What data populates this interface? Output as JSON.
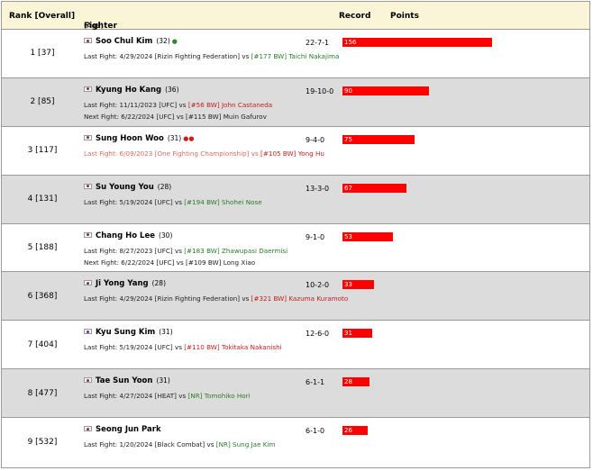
{
  "header": {
    "rank": "Rank [Overall]",
    "fighter": "Fighter",
    "age": "(Age)",
    "record": "Record",
    "points": "Points"
  },
  "colors": {
    "bar": "#ff0000",
    "header_bg": "#fbf5d8",
    "alt_row": "#dcdcdc",
    "win_text": "#2a7a2a",
    "loss_text": "#c21d1d"
  },
  "max_points": 156,
  "rows": [
    {
      "rank": "1 [37]",
      "name": "Soo Chul Kim",
      "age": "(32)",
      "record": "22-7-1",
      "points": "156",
      "l1": {
        "prefix": "Last Fight: 4/29/2024 [Rizin Fighting Federation] vs ",
        "opp": "[#177 BW] Taichi Nakajima",
        "tone": "green"
      }
    },
    {
      "rank": "2 [85]",
      "name": "Kyung Ho Kang",
      "age": "(36)",
      "record": "19-10-0",
      "points": "90",
      "l1": {
        "prefix": "Last Fight: 11/11/2023 [UFC] vs ",
        "opp": "[#56 BW] John Castaneda",
        "tone": "red"
      },
      "l2": {
        "prefix": "Next Fight: 6/22/2024 [UFC] vs ",
        "opp": "[#115 BW] Muin Gafurov",
        "tone": "dark"
      }
    },
    {
      "rank": "3 [117]",
      "name": "Sung Hoon Woo",
      "age": "(31)",
      "record": "9-4-0",
      "points": "75",
      "l1": {
        "prefix": "Last Fight: 6/09/2023 [One Fighting Championship] vs ",
        "opp": "[#105 BW] Yong Hu",
        "tone": "red"
      }
    },
    {
      "rank": "4 [131]",
      "name": "Su Young You",
      "age": "(28)",
      "record": "13-3-0",
      "points": "67",
      "l1": {
        "prefix": "Last Fight: 5/19/2024 [UFC] vs ",
        "opp": "[#194 BW] Shohei Nose",
        "tone": "green"
      }
    },
    {
      "rank": "5 [188]",
      "name": "Chang Ho Lee",
      "age": "(30)",
      "record": "9-1-0",
      "points": "53",
      "l1": {
        "prefix": "Last Fight: 8/27/2023 [UFC] vs ",
        "opp": "[#183 BW] Zhawupasi Daermisi",
        "tone": "green"
      },
      "l2": {
        "prefix": "Next Fight: 6/22/2024 [UFC] vs ",
        "opp": "[#109 BW] Long Xiao",
        "tone": "dark"
      }
    },
    {
      "rank": "6 [368]",
      "name": "Ji Yong Yang",
      "age": "(28)",
      "record": "10-2-0",
      "points": "33",
      "l1": {
        "prefix": "Last Fight: 4/29/2024 [Rizin Fighting Federation] vs ",
        "opp": "[#321 BW] Kazuma Kuramoto",
        "tone": "red"
      }
    },
    {
      "rank": "7 [404]",
      "name": "Kyu Sung Kim",
      "age": "(31)",
      "record": "12-6-0",
      "points": "31",
      "l1": {
        "prefix": "Last Fight: 5/19/2024 [UFC] vs ",
        "opp": "[#110 BW] Tokitaka Nakanishi",
        "tone": "red"
      }
    },
    {
      "rank": "8 [477]",
      "name": "Tae Sun Yoon",
      "age": "(31)",
      "record": "6-1-1",
      "points": "28",
      "l1": {
        "prefix": "Last Fight: 4/27/2024 [HEAT] vs ",
        "opp": "[NR] Tomohiko Hori",
        "tone": "green"
      }
    },
    {
      "rank": "9 [532]",
      "name": "Seong Jun Park",
      "age": "",
      "record": "6-1-0",
      "points": "26",
      "l1": {
        "prefix": "Last Fight: 1/20/2024 [Black Combat] vs ",
        "opp": "[NR] Sung Jae Kim",
        "tone": "green"
      }
    }
  ]
}
